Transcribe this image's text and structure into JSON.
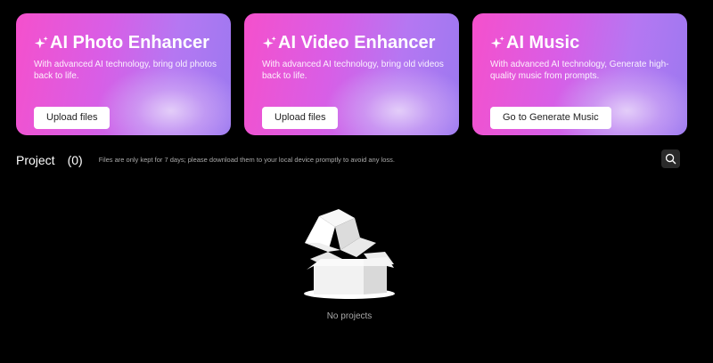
{
  "cards": [
    {
      "title": "AI Photo Enhancer",
      "description": "With advanced AI technology, bring old photos back to life.",
      "button": "Upload files",
      "icon": "sparkle-icon"
    },
    {
      "title": "AI Video Enhancer",
      "description": "With advanced AI technology, bring old videos back to life.",
      "button": "Upload files",
      "icon": "sparkle-icon"
    },
    {
      "title": "AI Music",
      "description": "With advanced AI technology, Generate high-quality music from prompts.",
      "button": "Go to Generate Music",
      "icon": "sparkle-icon"
    }
  ],
  "project": {
    "title": "Project",
    "count": "(0)",
    "note": "Files are only kept for 7 days; please download them to your local device promptly to avoid any loss.",
    "search_icon": "search-icon"
  },
  "empty_state": {
    "text": "No projects",
    "icon": "empty-box-icon"
  },
  "colors": {
    "background": "#000000",
    "card_gradient_start": "#f550cc",
    "card_gradient_end": "#9b79f0",
    "button_bg": "#ffffff",
    "muted_text": "#aaaaaa"
  }
}
